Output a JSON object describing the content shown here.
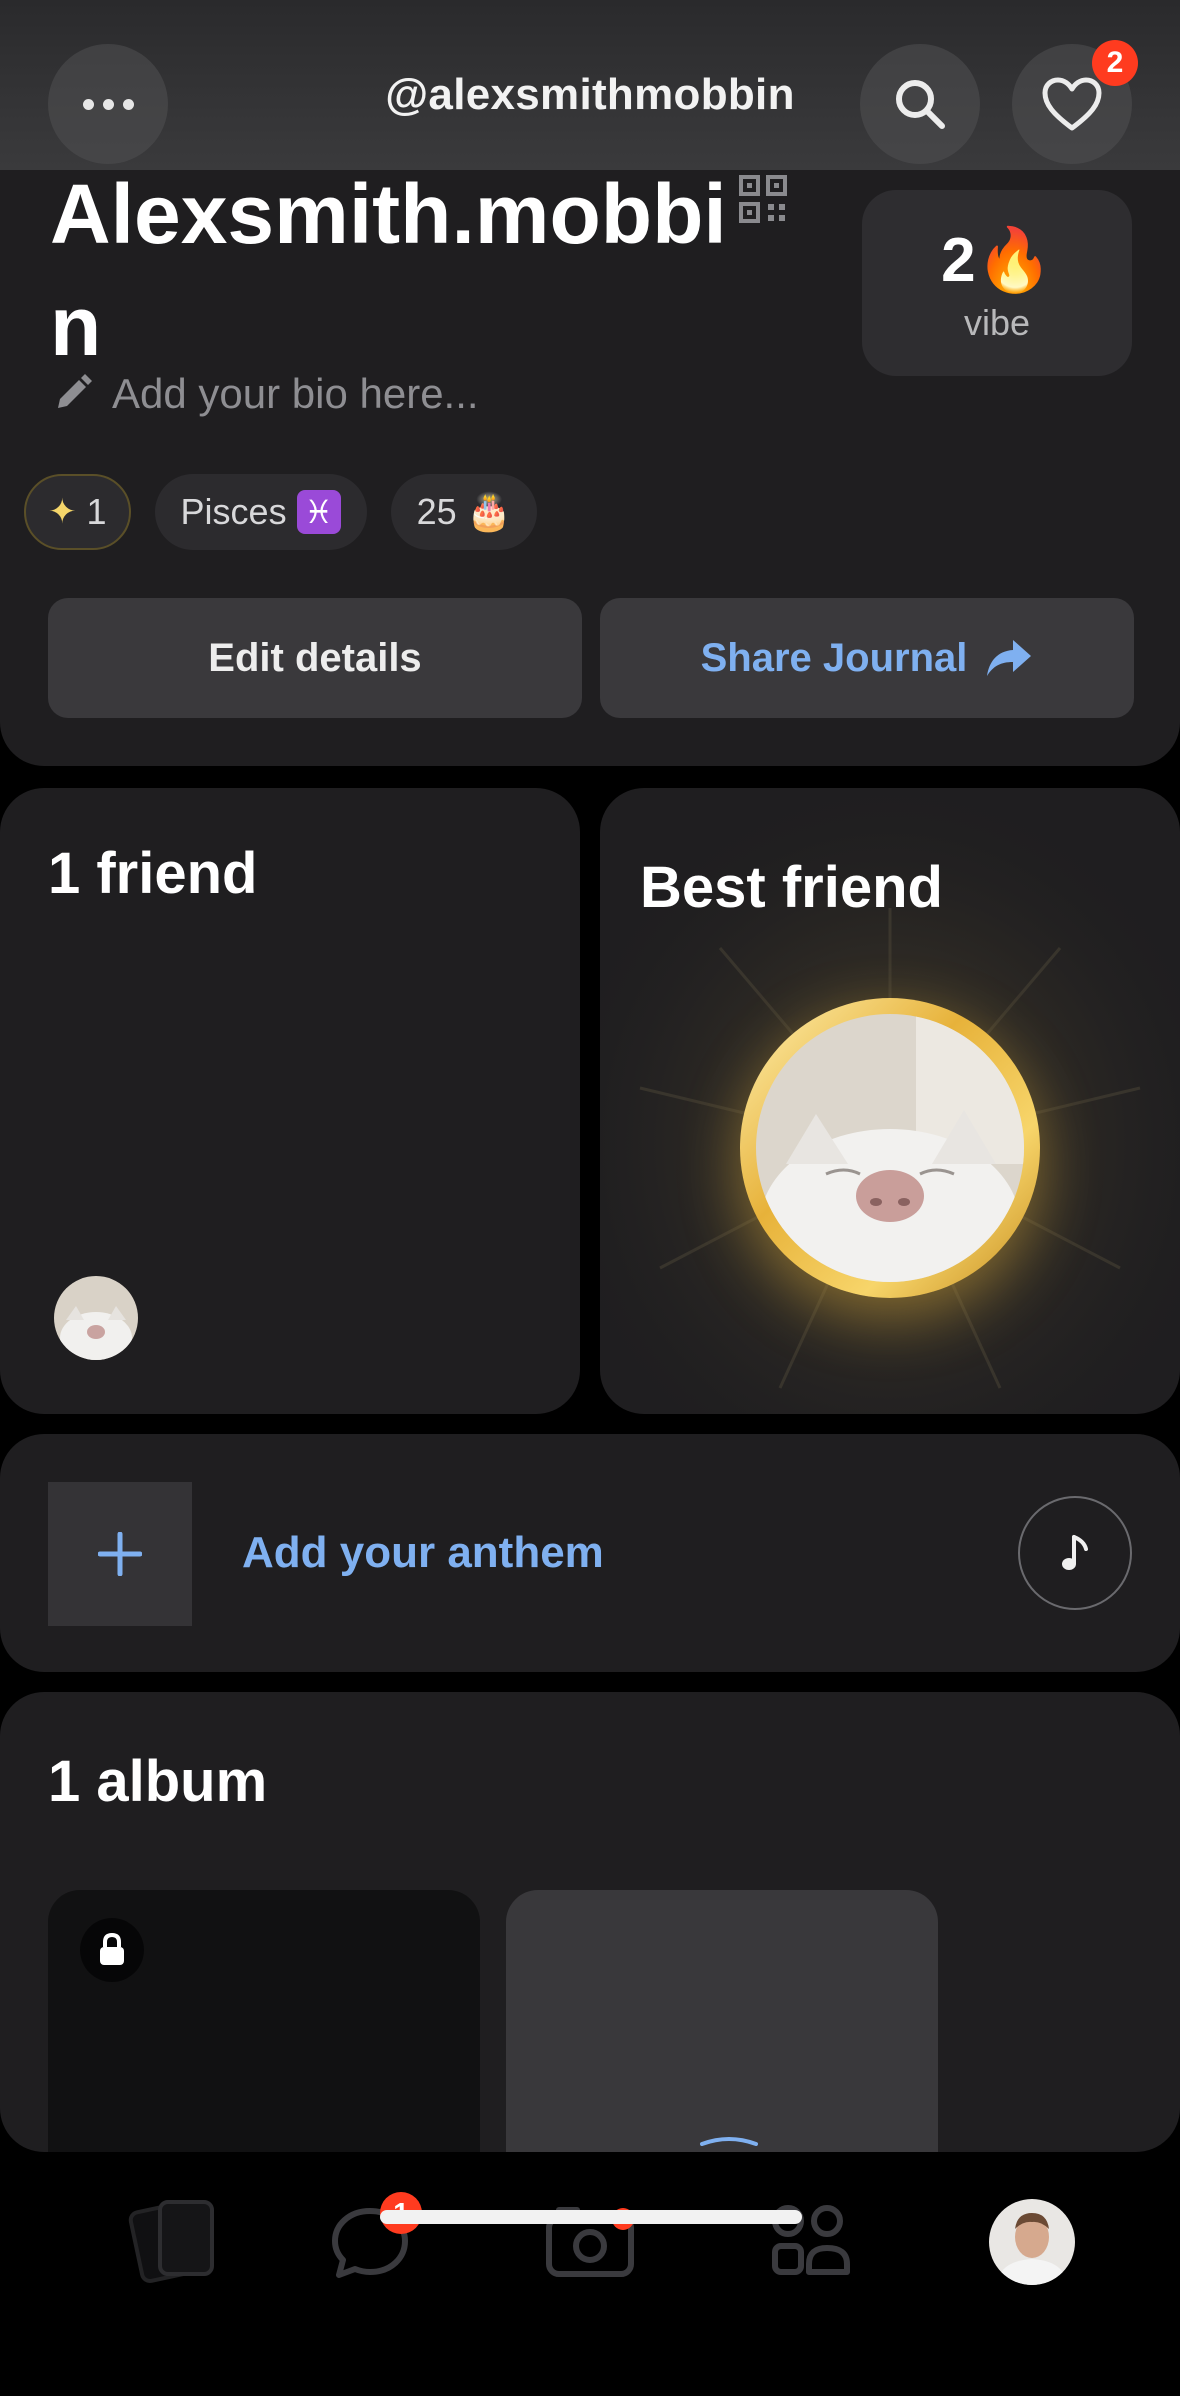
{
  "header": {
    "username": "@alexsmithmobbin",
    "notifications_count": "2",
    "icons": [
      "more-icon",
      "search-icon",
      "heart-icon"
    ]
  },
  "profile": {
    "display_name": "Alexsmith.mobbin",
    "vibe_count": "2🔥",
    "vibe_label": "vibe",
    "bio_placeholder": "Add your bio here...",
    "chips": {
      "spark": "1",
      "zodiac": "Pisces",
      "zodiac_symbol": "♓",
      "age": "25",
      "age_emoji": "🎂"
    },
    "edit_button": "Edit details",
    "share_button": "Share Journal"
  },
  "friends": {
    "title": "1 friend"
  },
  "best_friend": {
    "title": "Best friend"
  },
  "anthem": {
    "label": "Add your anthem"
  },
  "album": {
    "title": "1 album"
  },
  "nav": {
    "chat_badge": "1",
    "items": [
      "journal-icon",
      "chat-icon",
      "camera-icon",
      "friends-icon",
      "profile-avatar"
    ]
  },
  "colors": {
    "background": "#000000",
    "card": "#1f1e20",
    "accent_blue": "#7fb0f0",
    "badge_red": "#ff3b1f",
    "gold": "#e7b23a"
  }
}
